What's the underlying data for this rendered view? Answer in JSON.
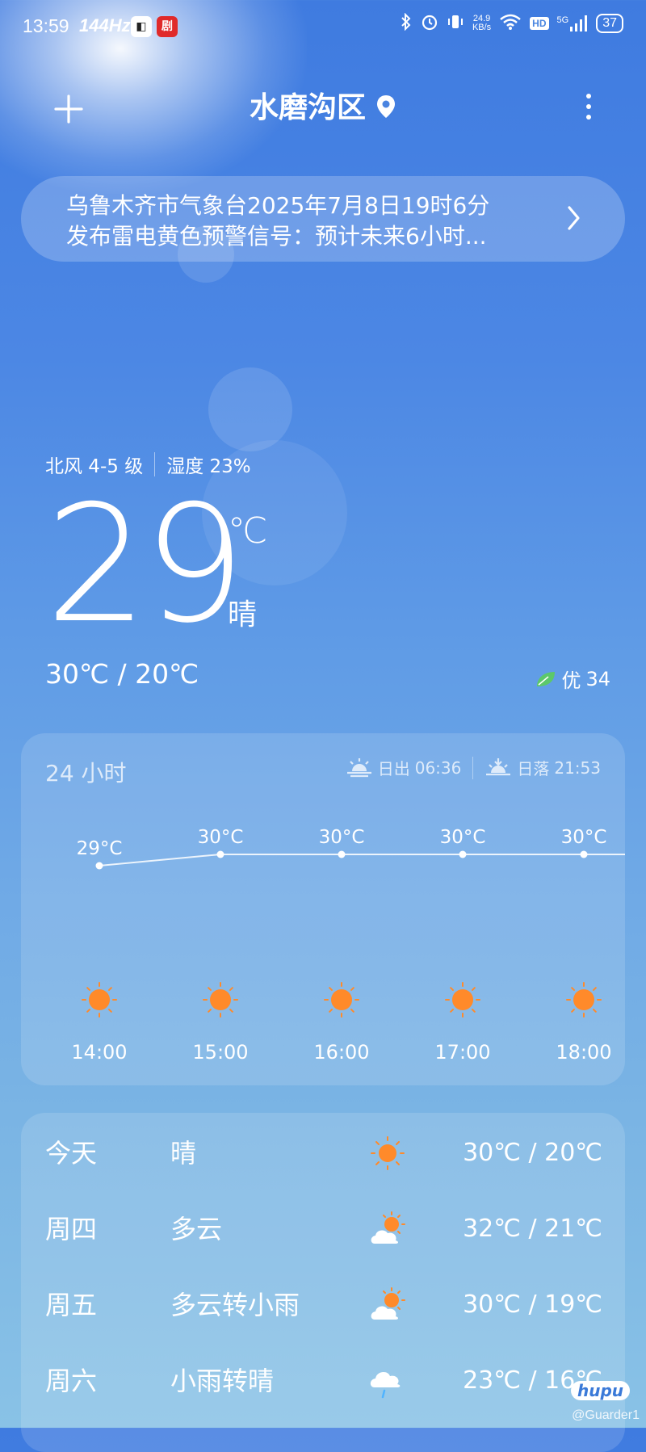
{
  "status_bar": {
    "time": "13:59",
    "refresh_rate": "144Hz",
    "network_speed_value": "24.9",
    "network_speed_unit": "KB/s",
    "signal_label": "5G",
    "hd_label": "HD",
    "battery": "37"
  },
  "header": {
    "city": "水磨沟区"
  },
  "alert": {
    "line1": "乌鲁木齐市气象台2025年7月8日19时6分",
    "line2": "发布雷电黄色预警信号：预计未来6小时..."
  },
  "current": {
    "wind": "北风 4-5 级",
    "humidity": "湿度 23%",
    "temperature": "29",
    "unit": "℃",
    "condition": "晴",
    "high_low": "30℃ / 20℃",
    "aqi_label": "优",
    "aqi_value": "34"
  },
  "hourly": {
    "title": "24 小时",
    "sunrise_label": "日出",
    "sunrise_time": "06:36",
    "sunset_label": "日落",
    "sunset_time": "21:53",
    "items": [
      {
        "time": "14:00",
        "temp": "29°C",
        "icon": "sun-icon"
      },
      {
        "time": "15:00",
        "temp": "30°C",
        "icon": "sun-icon"
      },
      {
        "time": "16:00",
        "temp": "30°C",
        "icon": "sun-icon"
      },
      {
        "time": "17:00",
        "temp": "30°C",
        "icon": "sun-icon"
      },
      {
        "time": "18:00",
        "temp": "30°C",
        "icon": "sun-icon"
      }
    ]
  },
  "daily": [
    {
      "day": "今天",
      "condition": "晴",
      "range": "30℃ / 20℃",
      "icon": "sun-icon"
    },
    {
      "day": "周四",
      "condition": "多云",
      "range": "32℃ / 21℃",
      "icon": "partly-cloudy-icon"
    },
    {
      "day": "周五",
      "condition": "多云转小雨",
      "range": "30℃ / 19℃",
      "icon": "partly-cloudy-icon"
    },
    {
      "day": "周六",
      "condition": "小雨转晴",
      "range": "23℃ / 16℃",
      "icon": "light-rain-icon"
    }
  ],
  "watermark": {
    "logo": "hupu",
    "user": "@Guarder1"
  },
  "colors": {
    "sun": "#ff8a2a",
    "leaf": "#5cc86a"
  }
}
